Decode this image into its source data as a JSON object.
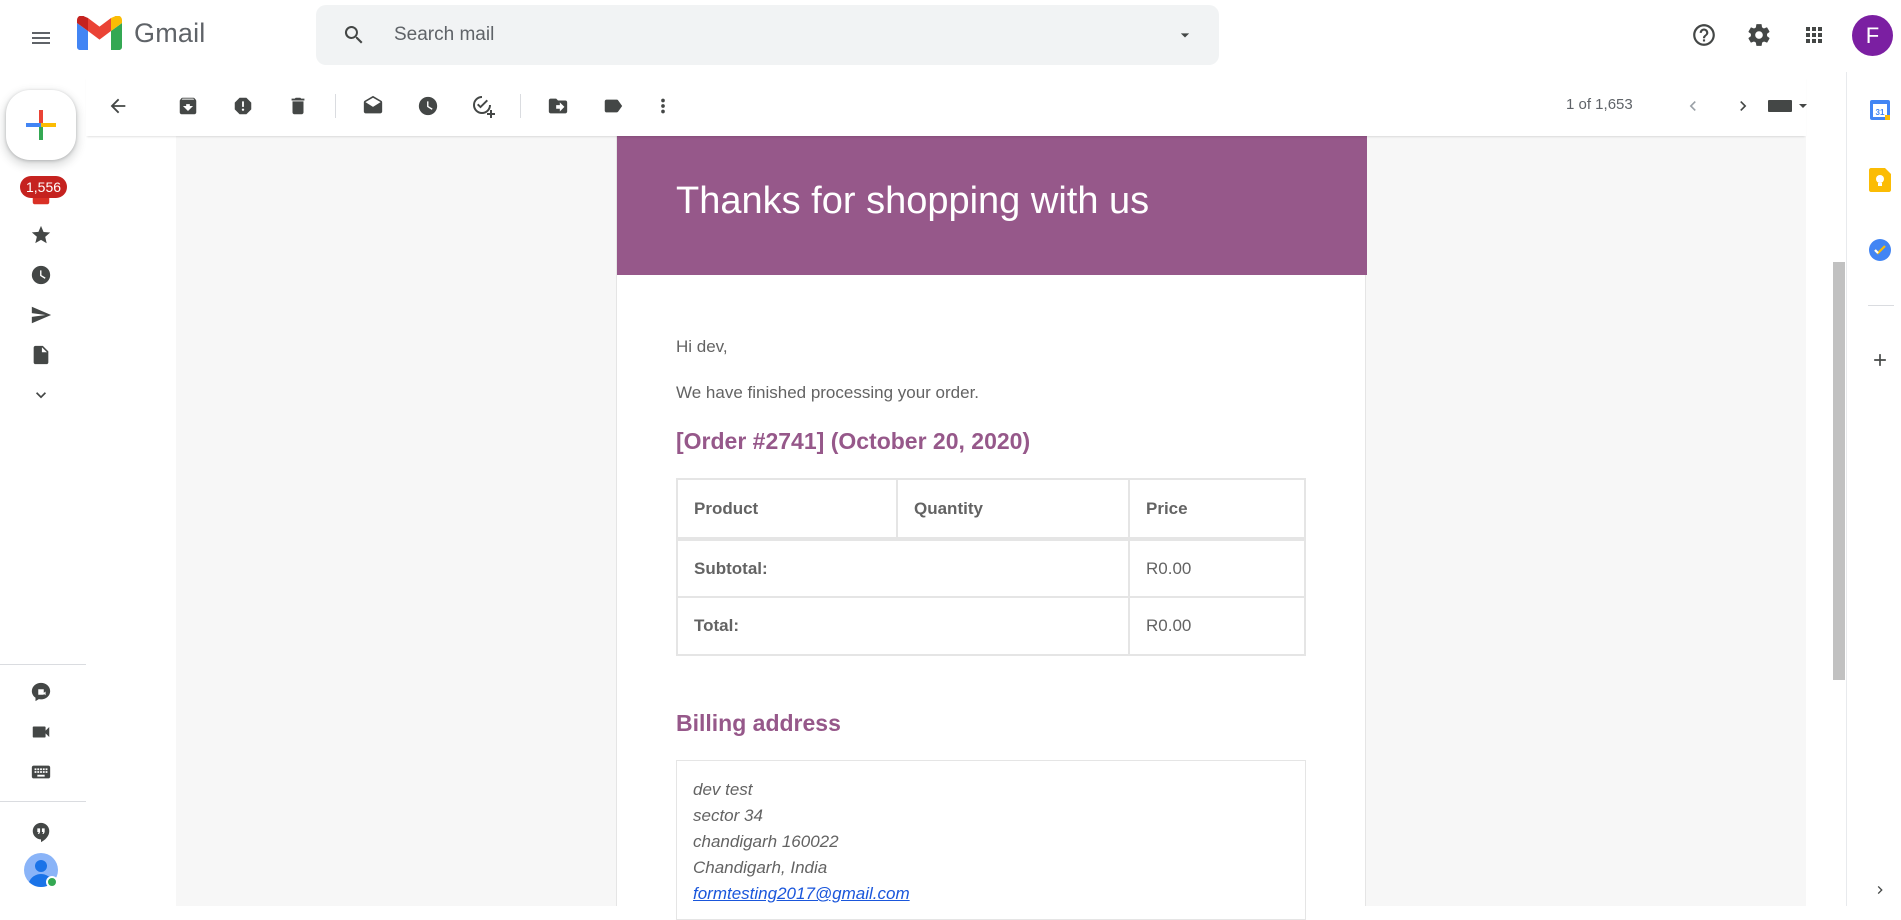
{
  "app": {
    "name": "Gmail",
    "avatar_letter": "F"
  },
  "search": {
    "placeholder": "Search mail"
  },
  "sidebar": {
    "inbox_badge": "1,556"
  },
  "toolbar": {
    "pager": "1 of 1,653"
  },
  "email": {
    "banner_title": "Thanks for shopping with us",
    "greeting": "Hi dev,",
    "message": "We have finished processing your order.",
    "order_heading": "[Order #2741] (October 20, 2020)",
    "table": {
      "headers": [
        "Product",
        "Quantity",
        "Price"
      ],
      "rows": [
        {
          "label": "Subtotal:",
          "value": "R0.00"
        },
        {
          "label": "Total:",
          "value": "R0.00"
        }
      ]
    },
    "billing_heading": "Billing address",
    "billing": {
      "name": "dev test",
      "line1": "sector 34",
      "line2": "chandigarh 160022",
      "line3": "Chandigarh, India",
      "email": "formtesting2017@gmail.com"
    }
  },
  "side_panel": {
    "calendar_day": "31"
  },
  "colors": {
    "accent": "#96588a",
    "badge": "#c5221f",
    "avatar": "#7b1fa2"
  }
}
